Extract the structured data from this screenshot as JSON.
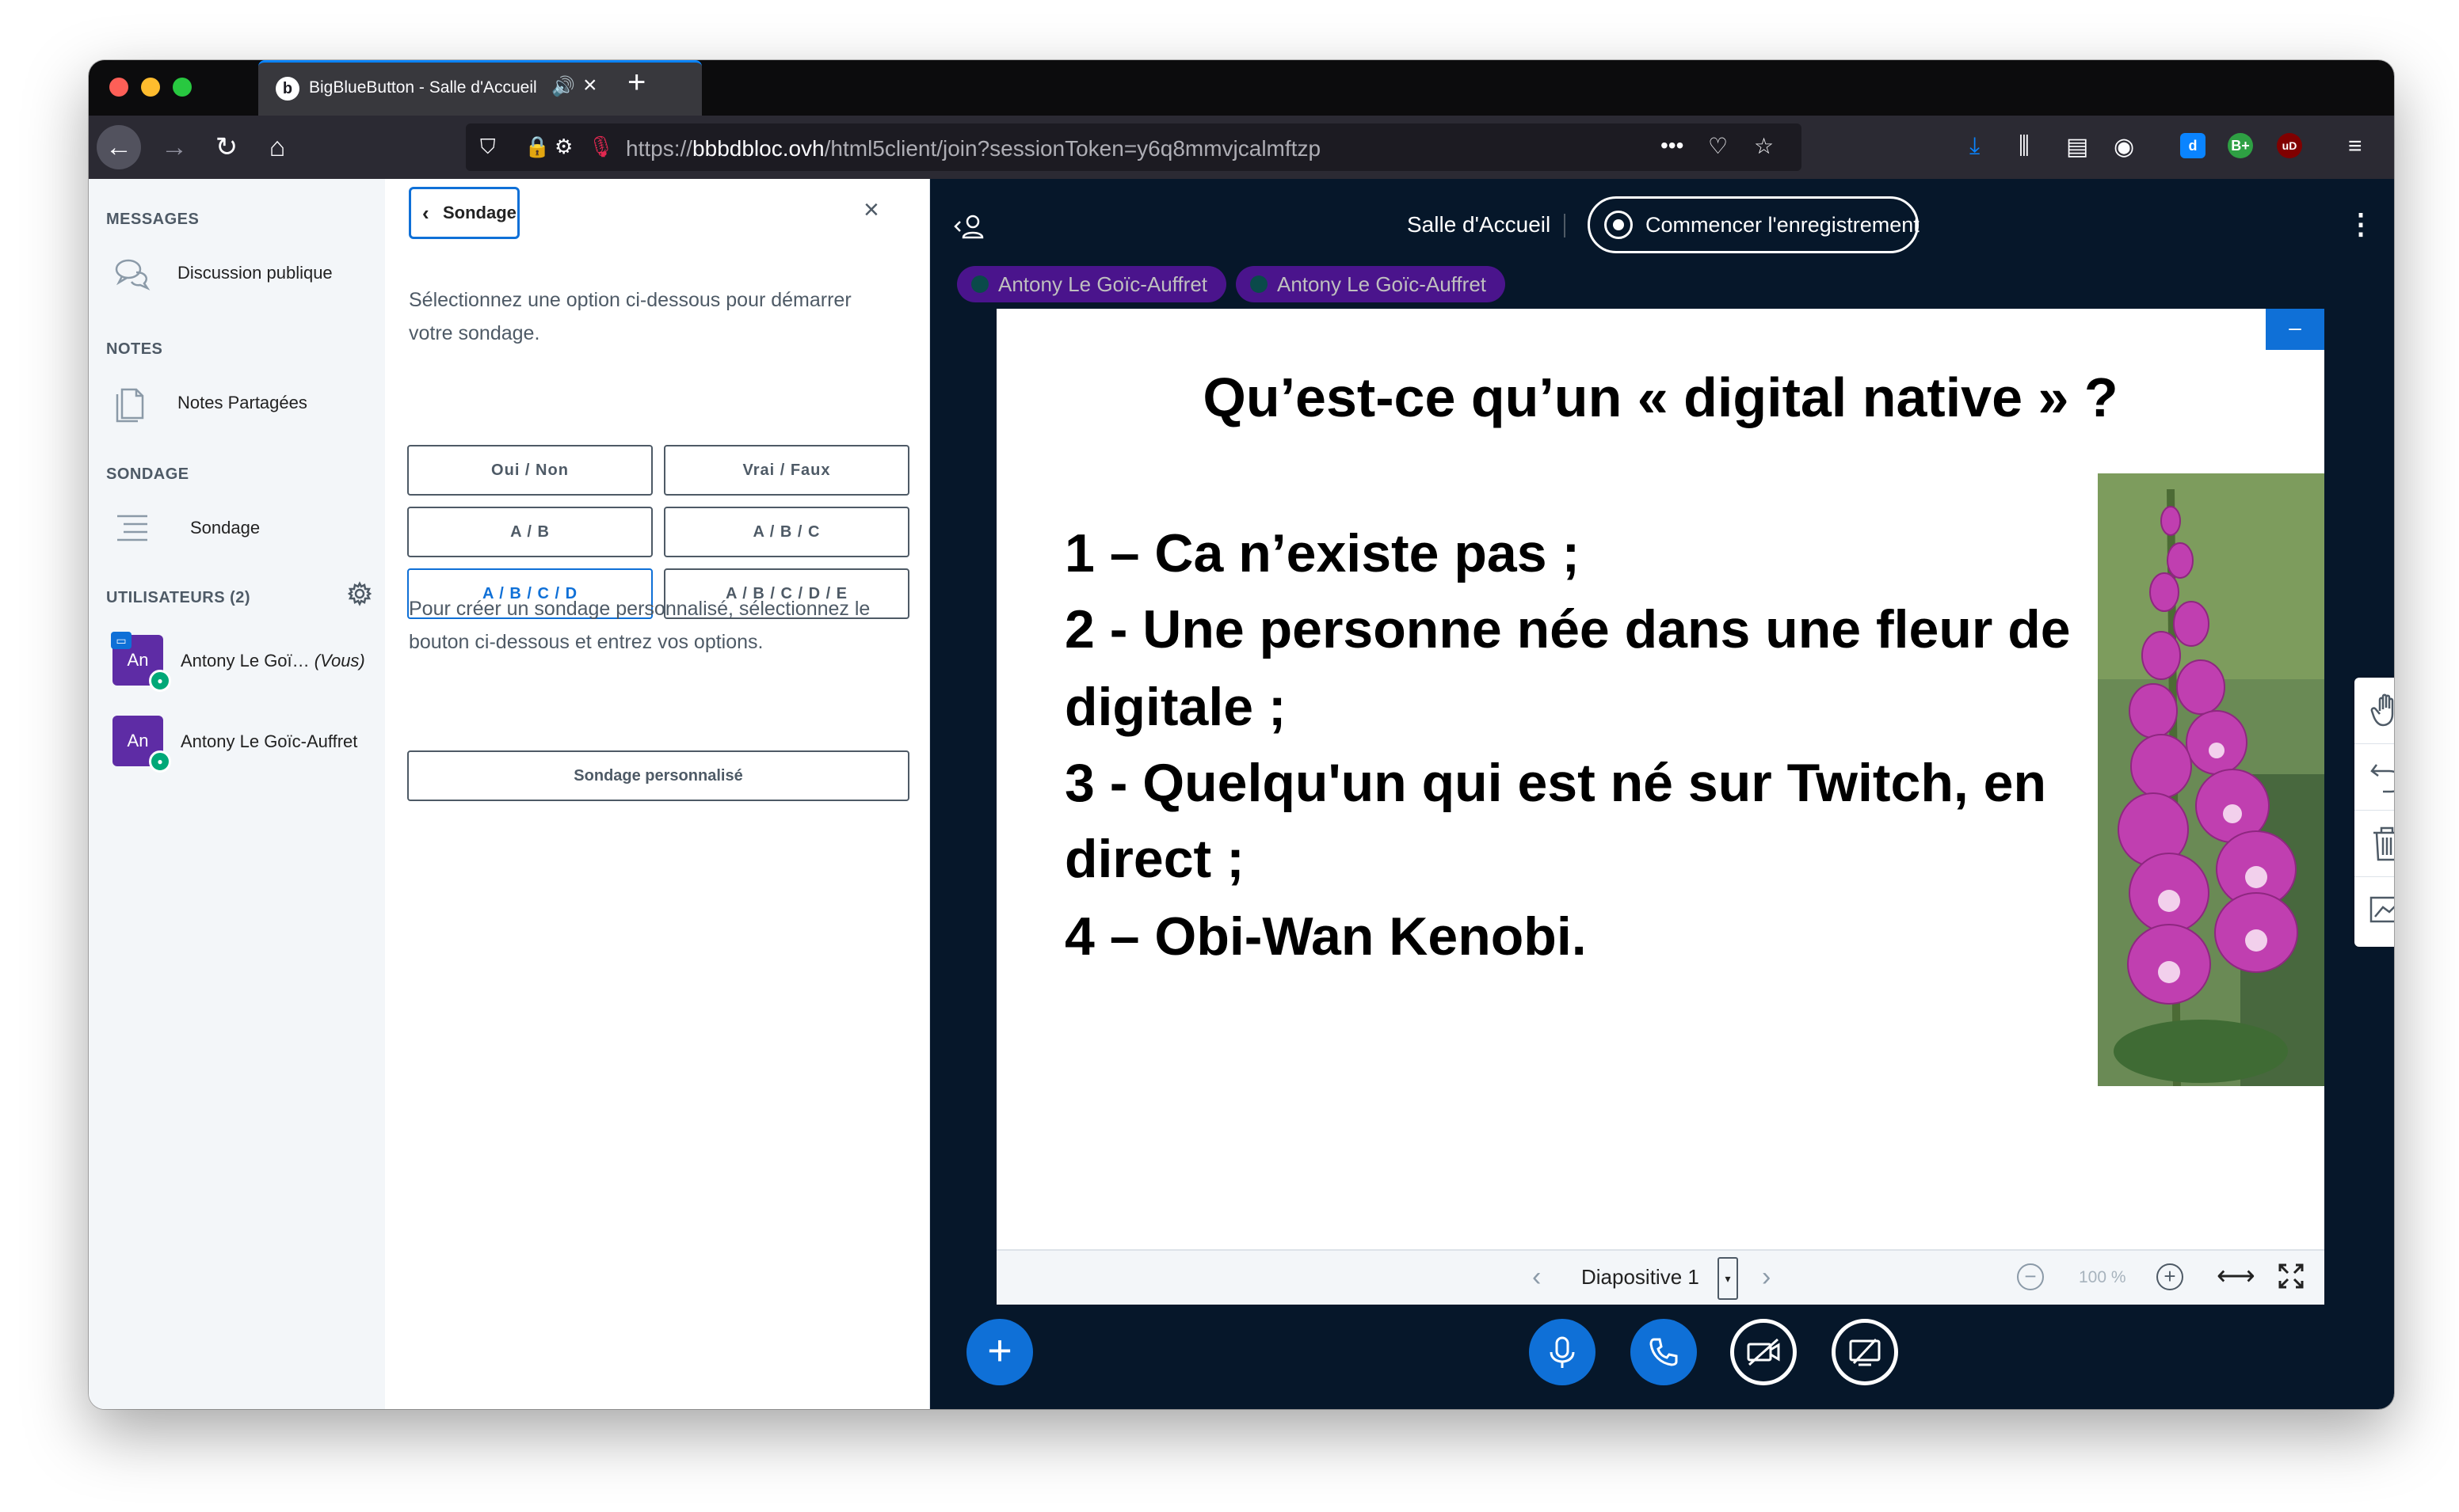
{
  "browser": {
    "tab_title": "BigBlueButton - Salle d'Accueil",
    "url_scheme": "https://",
    "url_host": "bbbdbloc.ovh",
    "url_path": "/html5client/join?sessionToken=y6q8mmvjcalmftzp",
    "url_ellipsis": "•••",
    "badge_bplus": "B+",
    "badge_ud": "uD",
    "badge_d": "d"
  },
  "sidebar": {
    "messages_heading": "MESSAGES",
    "public_chat_label": "Discussion publique",
    "notes_heading": "NOTES",
    "shared_notes_label": "Notes Partagées",
    "poll_heading": "SONDAGE",
    "poll_label": "Sondage",
    "users_heading": "UTILISATEURS (2)",
    "users": [
      {
        "initials": "An",
        "name": "Antony Le Goï…",
        "suffix": "(Vous)"
      },
      {
        "initials": "An",
        "name": "Antony Le Goïc-Auffret",
        "suffix": ""
      }
    ]
  },
  "poll_panel": {
    "back_label": "Sondage",
    "intro_hint": "Sélectionnez une option ci-dessous pour démarrer votre sondage.",
    "options": [
      "Oui / Non",
      "Vrai / Faux",
      "A / B",
      "A / B / C",
      "A / B / C / D",
      "A / B / C / D / E"
    ],
    "active_option": "A / B / C / D",
    "custom_hint": "Pour créer un sondage personnalisé, sélectionnez le bouton ci-dessous et entrez vos options.",
    "custom_button": "Sondage personnalisé"
  },
  "main": {
    "meeting_title": "Salle d'Accueil",
    "record_button": "Commencer l'enregistrement",
    "talkers": [
      "Antony Le Goïc-Auffret",
      "Antony Le Goïc-Auffret"
    ]
  },
  "slide": {
    "title": "Qu’est-ce qu’un « digital native » ?",
    "lines": [
      "1 – Ca n’existe pas ;",
      "2 - Une personne née dans une fleur de",
      "digitale ;",
      "3 - Quelqu'un qui est né sur Twitch, en",
      "direct ;",
      "4 – Obi-Wan Kenobi."
    ],
    "minimize_label": "–"
  },
  "slide_toolbar": {
    "slide_label": "Diapositive 1",
    "zoom_value": "100 %"
  },
  "colors": {
    "accent": "#0f70d7",
    "app_background": "#06172a",
    "talker_background": "#4a148c",
    "avatar": "#5e2ca5"
  }
}
